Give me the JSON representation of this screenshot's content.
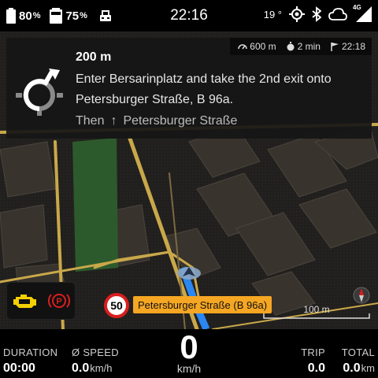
{
  "status_bar": {
    "battery1": {
      "value": "80",
      "unit": "%"
    },
    "battery2": {
      "value": "75",
      "unit": "%"
    },
    "clock": "22:16",
    "temperature": "19 °",
    "signal_label": "4G",
    "icons": [
      "battery-icon",
      "phone-battery-icon",
      "car-icon",
      "gps-icon",
      "bluetooth-icon",
      "cloud-icon",
      "signal-icon"
    ]
  },
  "navigation": {
    "eta": {
      "distance": "600 m",
      "time": "2 min",
      "arrival": "22:18"
    },
    "maneuver_icon": "roundabout-icon",
    "distance": "200 m",
    "instruction": "Enter Bersarinplatz and take the 2nd exit onto Petersburger Straße, B 96a.",
    "then_label": "Then",
    "then_arrow": "↑",
    "then_street": "Petersburger Straße"
  },
  "map": {
    "speed_limit": "50",
    "street_name": "Petersburger Straße (B 96a)",
    "scale": "100 m",
    "colors": {
      "road": "#c9a84a",
      "route": "#2a86f0",
      "park": "#2c5a2c",
      "building": "#3a3530"
    }
  },
  "warning_lights": [
    "engine-check-icon",
    "parking-brake-icon"
  ],
  "bottom": {
    "duration": {
      "label": "DURATION",
      "value": "00:00"
    },
    "avg_speed": {
      "label": "Ø SPEED",
      "value": "0.0",
      "unit": "km/h"
    },
    "speed": {
      "value": "0",
      "unit": "km/h"
    },
    "trip": {
      "label": "TRIP",
      "value": "0.0"
    },
    "total": {
      "label": "TOTAL",
      "value": "0.0",
      "unit": "km"
    }
  }
}
